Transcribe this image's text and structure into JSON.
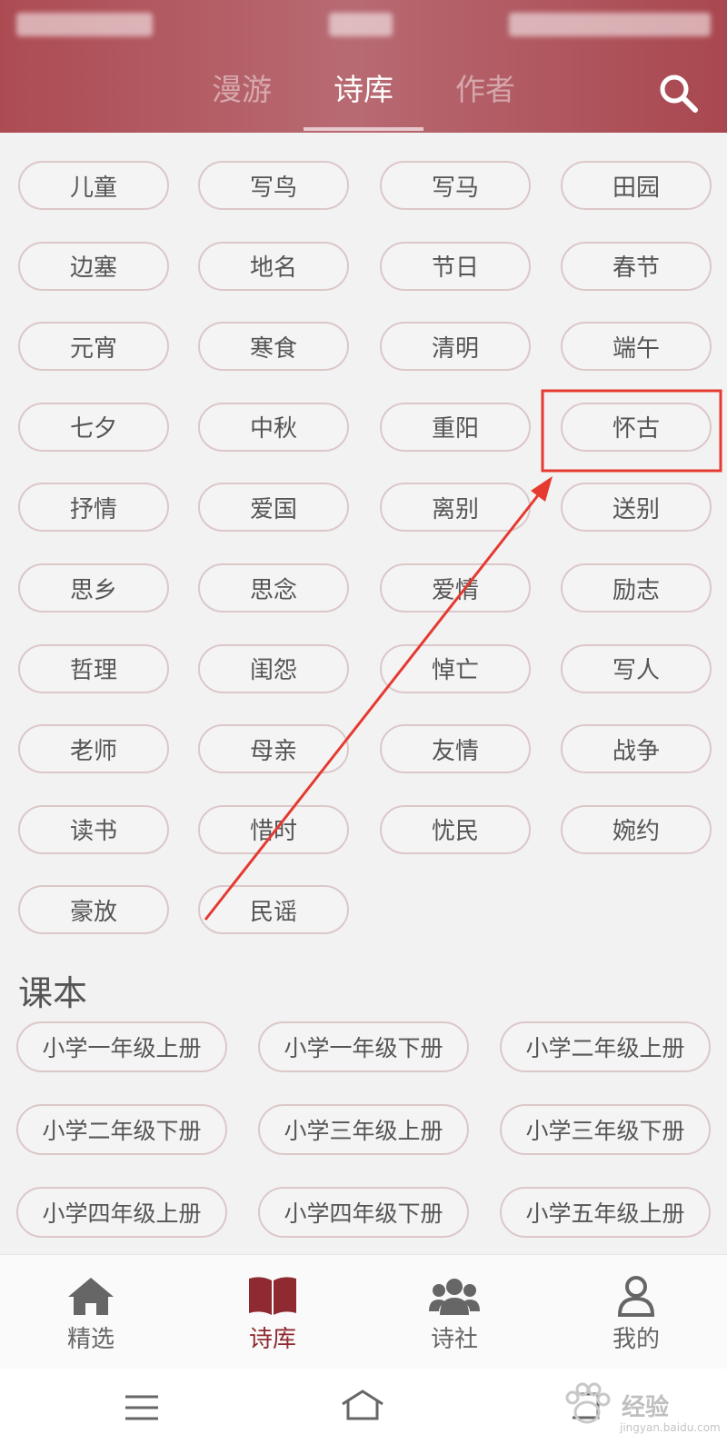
{
  "header": {
    "tabs": [
      {
        "label": "漫游",
        "active": false
      },
      {
        "label": "诗库",
        "active": true
      },
      {
        "label": "作者",
        "active": false
      }
    ],
    "search_icon": "search-icon"
  },
  "tags": [
    "儿童",
    "写鸟",
    "写马",
    "田园",
    "边塞",
    "地名",
    "节日",
    "春节",
    "元宵",
    "寒食",
    "清明",
    "端午",
    "七夕",
    "中秋",
    "重阳",
    "怀古",
    "抒情",
    "爱国",
    "离别",
    "送别",
    "思乡",
    "思念",
    "爱情",
    "励志",
    "哲理",
    "闺怨",
    "悼亡",
    "写人",
    "老师",
    "母亲",
    "友情",
    "战争",
    "读书",
    "惜时",
    "忧民",
    "婉约",
    "豪放",
    "民谣"
  ],
  "textbook": {
    "title": "课本",
    "items": [
      "小学一年级上册",
      "小学一年级下册",
      "小学二年级上册",
      "小学二年级下册",
      "小学三年级上册",
      "小学三年级下册",
      "小学四年级上册",
      "小学四年级下册",
      "小学五年级上册"
    ]
  },
  "bottom_nav": [
    {
      "label": "精选",
      "icon": "home-icon",
      "active": false
    },
    {
      "label": "诗库",
      "icon": "book-icon",
      "active": true
    },
    {
      "label": "诗社",
      "icon": "group-icon",
      "active": false
    },
    {
      "label": "我的",
      "icon": "user-icon",
      "active": false
    }
  ],
  "system_nav": {
    "icons": [
      "menu-icon",
      "home-outline-icon",
      "back-icon"
    ]
  },
  "watermark": {
    "text": "经验",
    "url": "jingyan.baidu.com"
  },
  "annotation": {
    "highlighted_tag": "怀古",
    "color": "#e53a30"
  },
  "colors": {
    "header": "#ad4b53",
    "accent": "#8f2a31",
    "pill_border": "#dcc7c9"
  }
}
